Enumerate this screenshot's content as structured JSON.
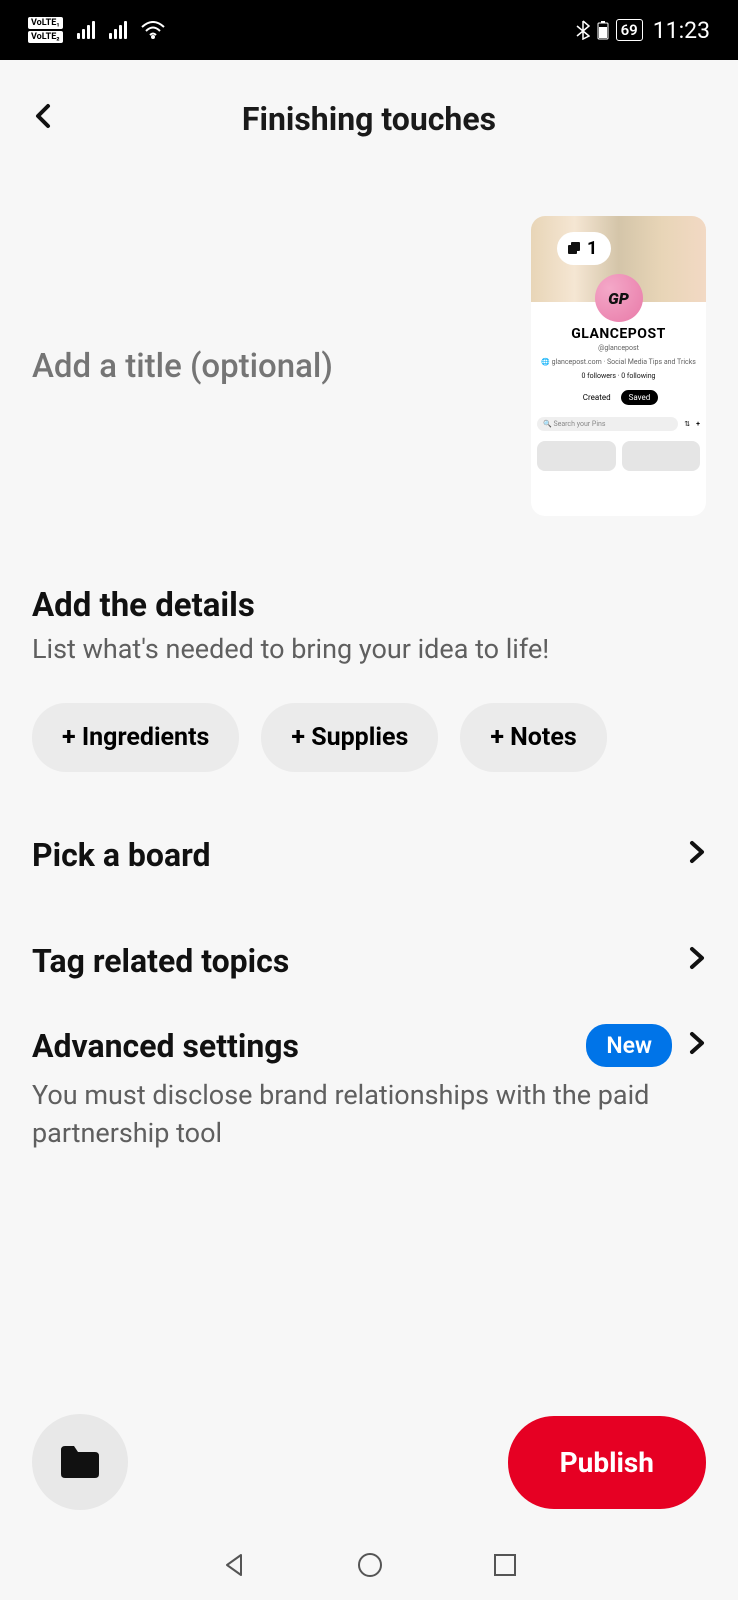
{
  "status_bar": {
    "volte1": "VoLTE₁",
    "volte2": "VoLTE₂",
    "battery_pct": "69",
    "time": "11:23"
  },
  "header": {
    "title": "Finishing touches"
  },
  "title_input": {
    "placeholder": "Add a title (optional)"
  },
  "preview": {
    "count": "1",
    "profile_name": "GLANCEPOST",
    "handle": "@glancepost",
    "site_line": "glancepost.com · Social Media Tips and Tricks",
    "stats": "0 followers · 0 following",
    "tab_created": "Created",
    "tab_saved": "Saved",
    "search_placeholder": "Search your Pins"
  },
  "details": {
    "title": "Add the details",
    "subtitle": "List what's needed to bring your idea to life!",
    "chips": {
      "ingredients": "+ Ingredients",
      "supplies": "+ Supplies",
      "notes": "+ Notes"
    }
  },
  "rows": {
    "pick_board": "Pick a board",
    "tag_topics": "Tag related topics",
    "advanced": "Advanced settings",
    "advanced_sub": "You must disclose brand relationships with the paid partnership tool",
    "badge_new": "New"
  },
  "bottom": {
    "publish": "Publish"
  }
}
